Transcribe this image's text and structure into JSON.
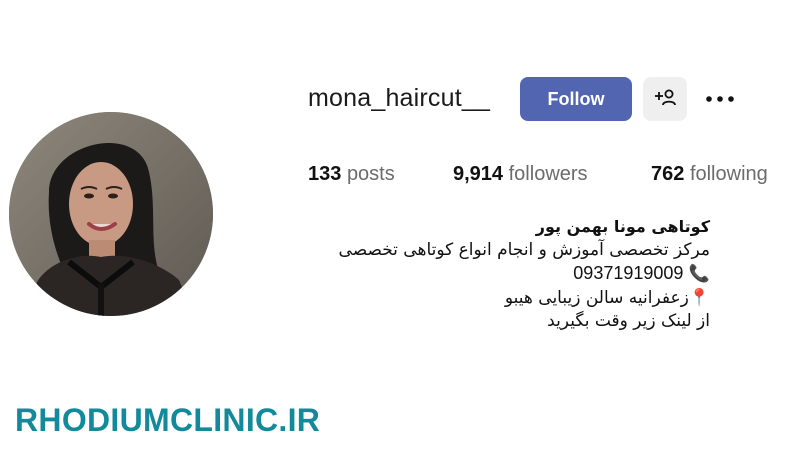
{
  "profile": {
    "username": "mona_haircut__",
    "follow_label": "Follow"
  },
  "stats": {
    "posts": {
      "count": "133",
      "label": "posts"
    },
    "followers": {
      "count": "9,914",
      "label": "followers"
    },
    "following": {
      "count": "762",
      "label": "following"
    }
  },
  "bio": {
    "name": "کوتاهی مونا بهمن پور",
    "line1": "مرکز تخصصی آموزش و انجام انواع کوتاهی تخصصی",
    "phone": "09371919009",
    "phone_emoji": "📞",
    "address_emoji": "📍",
    "address": "زعفرانیه سالن زیبایی هیبو",
    "line4": "از لینک زیر وقت بگیرید"
  },
  "watermark": "RHODIUMCLINIC.IR",
  "colors": {
    "follow_button": "#5165b1",
    "icon_button_bg": "#efefef",
    "watermark": "#138a9c",
    "secondary_text": "#6b6b6b"
  },
  "icons": {
    "suggest": "person-plus-icon",
    "more": "more-options-icon",
    "phone": "telephone-receiver-icon",
    "address": "map-pin-icon"
  }
}
